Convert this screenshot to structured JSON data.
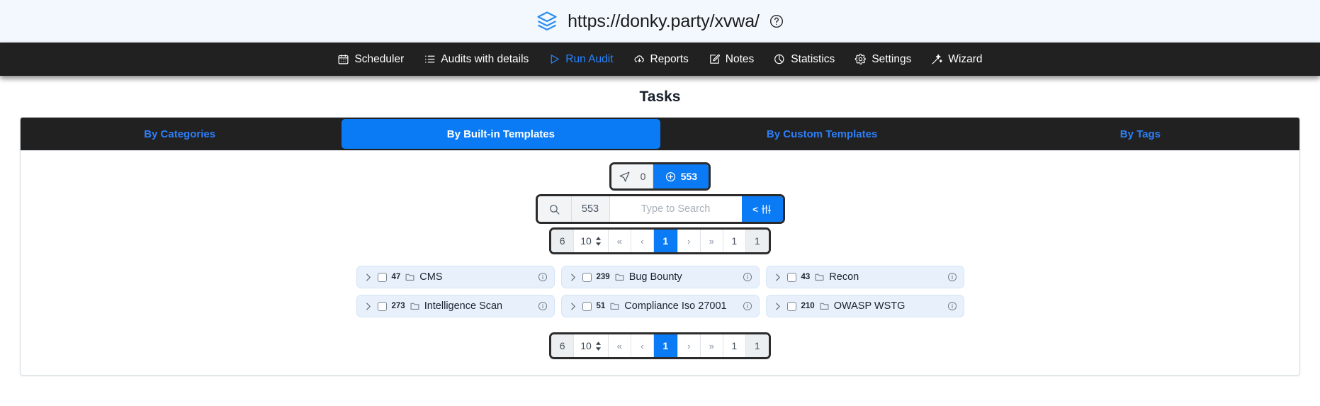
{
  "header": {
    "url": "https://donky.party/xvwa/",
    "logo_icon": "layers-icon",
    "help_icon": "help-circle-icon"
  },
  "navbar": {
    "items": [
      {
        "label": "Scheduler",
        "icon": "calendar-icon",
        "active": false
      },
      {
        "label": "Audits with details",
        "icon": "list-details-icon",
        "active": false
      },
      {
        "label": "Run Audit",
        "icon": "play-triangle-icon",
        "active": true
      },
      {
        "label": "Reports",
        "icon": "cloud-download-icon",
        "active": false
      },
      {
        "label": "Notes",
        "icon": "edit-square-icon",
        "active": false
      },
      {
        "label": "Statistics",
        "icon": "pie-chart-icon",
        "active": false
      },
      {
        "label": "Settings",
        "icon": "gear-icon",
        "active": false
      },
      {
        "label": "Wizard",
        "icon": "magic-wand-icon",
        "active": false
      }
    ]
  },
  "page": {
    "title": "Tasks"
  },
  "tabs": [
    {
      "label": "By Categories",
      "active": false
    },
    {
      "label": "By Built-in Templates",
      "active": true
    },
    {
      "label": "By Custom Templates",
      "active": false
    },
    {
      "label": "By Tags",
      "active": false
    }
  ],
  "counters": {
    "send_icon": "send-arrow-icon",
    "queued": "0",
    "plus_icon": "plus-circle-icon",
    "total": "553"
  },
  "search": {
    "search_icon": "search-icon",
    "count": "553",
    "value": "",
    "placeholder": "Type to Search",
    "filter_label": "<",
    "filter_icon": "sliders-icon"
  },
  "pagination": {
    "total_pages_label": "6",
    "page_size": "10",
    "first_label": "«",
    "prev_label": "‹",
    "current_page": "1",
    "next_label": "›",
    "last_label": "»",
    "jump_value": "1",
    "tail_value": "1"
  },
  "list": {
    "items": [
      {
        "count": "47",
        "label": "CMS",
        "chevron_icon": "chevron-right-icon",
        "folder_icon": "folder-icon",
        "info_icon": "info-circle-icon"
      },
      {
        "count": "239",
        "label": "Bug Bounty",
        "chevron_icon": "chevron-right-icon",
        "folder_icon": "folder-icon",
        "info_icon": "info-circle-icon"
      },
      {
        "count": "43",
        "label": "Recon",
        "chevron_icon": "chevron-right-icon",
        "folder_icon": "folder-icon",
        "info_icon": "info-circle-icon"
      },
      {
        "count": "273",
        "label": "Intelligence Scan",
        "chevron_icon": "chevron-right-icon",
        "folder_icon": "folder-icon",
        "info_icon": "info-circle-icon"
      },
      {
        "count": "51",
        "label": "Compliance Iso 27001",
        "chevron_icon": "chevron-right-icon",
        "folder_icon": "folder-icon",
        "info_icon": "info-circle-icon"
      },
      {
        "count": "210",
        "label": "OWASP WSTG",
        "chevron_icon": "chevron-right-icon",
        "folder_icon": "folder-icon",
        "info_icon": "info-circle-icon"
      }
    ]
  },
  "colors": {
    "accent_blue": "#0b7bf5",
    "nav_dark": "#212121",
    "tab_link": "#2d7ff9",
    "item_bg": "#e8f1fb",
    "header_bg": "#f2f8fe"
  }
}
